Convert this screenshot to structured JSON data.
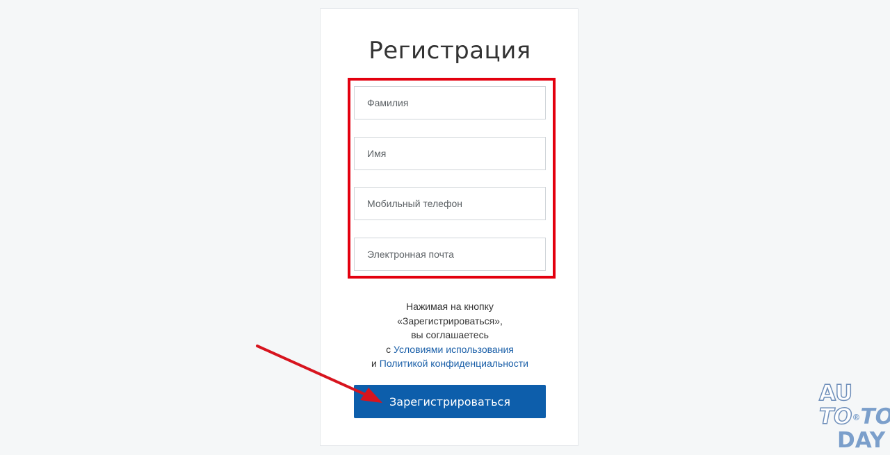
{
  "form": {
    "title": "Регистрация",
    "fields": [
      {
        "placeholder": "Фамилия",
        "value": ""
      },
      {
        "placeholder": "Имя",
        "value": ""
      },
      {
        "placeholder": "Мобильный телефон",
        "value": ""
      },
      {
        "placeholder": "Электронная почта",
        "value": ""
      }
    ],
    "agreement": {
      "line1": "Нажимая на кнопку",
      "line2": "«Зарегистрироваться»,",
      "line3": "вы соглашаетесь",
      "prefix_terms": "с ",
      "terms_link": "Условиями использования",
      "prefix_privacy": "и ",
      "privacy_link": "Политикой конфиденциальности"
    },
    "submit_label": "Зарегистрироваться"
  },
  "colors": {
    "highlight": "#e3000f",
    "button": "#0d5eab",
    "link": "#1a5fa8",
    "arrow": "#d7141e"
  },
  "watermark": {
    "line1": "AU",
    "line2_a": "TO",
    "line2_dot": "®",
    "line2_b": "TO",
    "line3": "DAY"
  }
}
